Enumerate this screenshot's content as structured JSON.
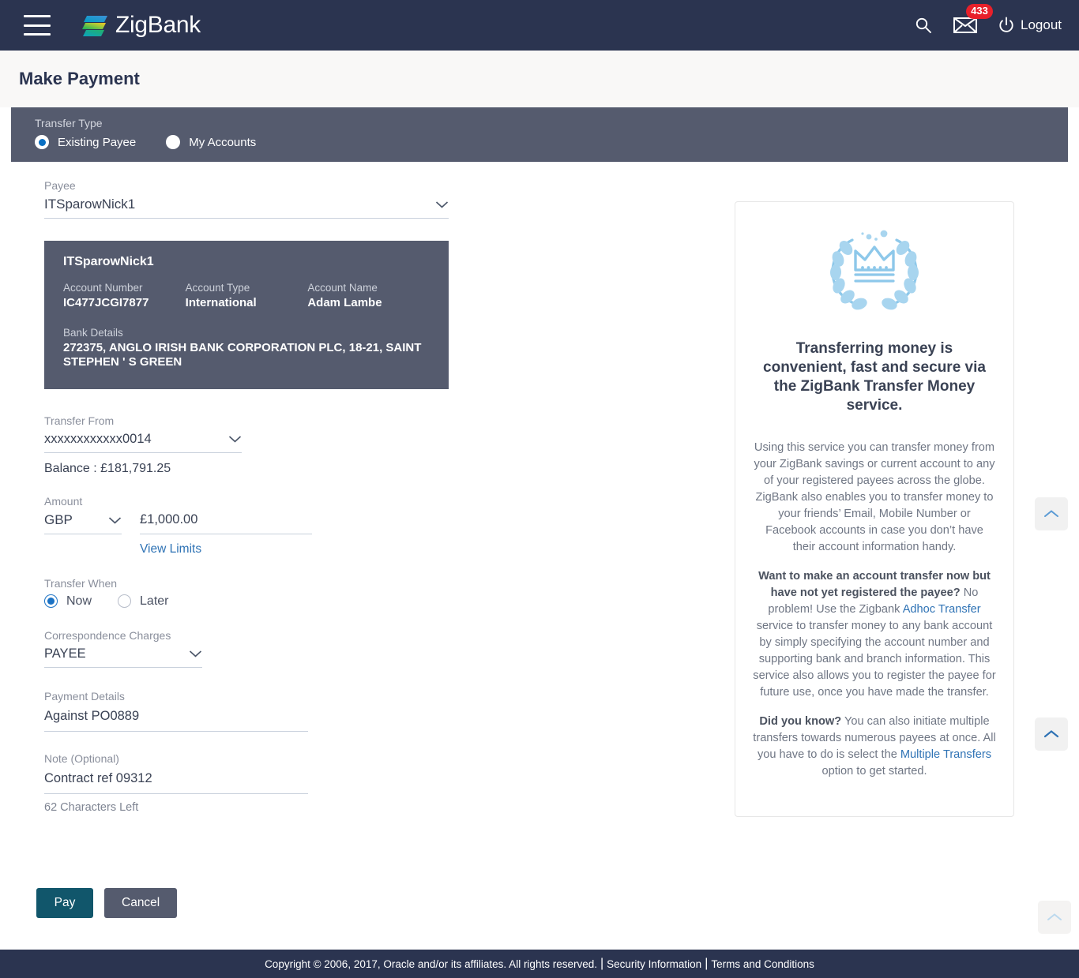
{
  "header": {
    "menu_icon": "hamburger-menu-icon",
    "brand_name": "ZigBank",
    "search_icon": "search-icon",
    "mail_icon": "mail-icon",
    "mail_badge": "433",
    "power_icon": "power-icon",
    "logout_label": "Logout"
  },
  "page": {
    "title": "Make Payment"
  },
  "transfer_type": {
    "label": "Transfer Type",
    "options": [
      {
        "label": "Existing Payee",
        "selected": true
      },
      {
        "label": "My Accounts",
        "selected": false
      }
    ]
  },
  "payee": {
    "label": "Payee",
    "value": "ITSparowNick1",
    "card": {
      "title": "ITSparowNick1",
      "account_number_label": "Account Number",
      "account_number_value": "IC477JCGI7877",
      "account_type_label": "Account Type",
      "account_type_value": "International",
      "account_name_label": "Account Name",
      "account_name_value": "Adam Lambe",
      "bank_details_label": "Bank Details",
      "bank_details_value": "272375, ANGLO IRISH BANK CORPORATION PLC, 18-21, SAINT STEPHEN ' S GREEN"
    }
  },
  "transfer_from": {
    "label": "Transfer From",
    "value": "xxxxxxxxxxxx0014",
    "balance": "Balance : £181,791.25"
  },
  "amount": {
    "label": "Amount",
    "currency": "GBP",
    "value": "£1,000.00",
    "placeholder": "",
    "view_limits_label": "View Limits"
  },
  "transfer_when": {
    "label": "Transfer When",
    "options": [
      {
        "label": "Now",
        "selected": true
      },
      {
        "label": "Later",
        "selected": false
      }
    ]
  },
  "correspondence_charges": {
    "label": "Correspondence Charges",
    "value": "PAYEE"
  },
  "payment_details": {
    "label": "Payment Details",
    "value": "Against PO0889",
    "placeholder": ""
  },
  "note": {
    "label": "Note (Optional)",
    "value": "Contract ref 09312",
    "placeholder": "",
    "chars_left": "62 Characters Left"
  },
  "actions": {
    "pay_label": "Pay",
    "cancel_label": "Cancel"
  },
  "info_panel": {
    "icon": "crown-laurel-wreath-icon",
    "heading": "Transferring money is convenient, fast and secure via the ZigBank Transfer Money service.",
    "para1": "Using this service you can transfer money from your ZigBank savings or current account to any of your registered payees across the globe. ZigBank also enables you to transfer money to your friends’ Email, Mobile Number or Facebook accounts in case you don’t have their account information handy.",
    "para2_bold": "Want to make an account transfer now but have not yet registered the payee?",
    "para2_pre": "No problem! Use the Zigbank ",
    "para2_link": "Adhoc Transfer",
    "para2_post": " service to transfer money to any bank account by simply specifying the account number and supporting bank and branch information. This service also allows you to register the payee for future use, once you have made the transfer.",
    "para3_bold": "Did you know?",
    "para3_pre": "You can also initiate multiple transfers towards numerous payees at once. All you have to do is select the ",
    "para3_link": "Multiple Transfers",
    "para3_post": " option to get started."
  },
  "scroll_buttons": {
    "icon": "chevron-up-icon"
  },
  "footer": {
    "copyright": "Copyright © 2006, 2017, Oracle and/or its affiliates. All rights reserved.",
    "security_link": "Security Information",
    "terms_link": "Terms and Conditions",
    "separator": "|"
  },
  "colors": {
    "header_bg": "#2b3450",
    "slate_panel": "#555b6e",
    "accent_blue": "#2f73b5",
    "pay_button": "#11566b",
    "badge_red": "#e8202a",
    "icon_light_blue": "#8dc8ea"
  }
}
